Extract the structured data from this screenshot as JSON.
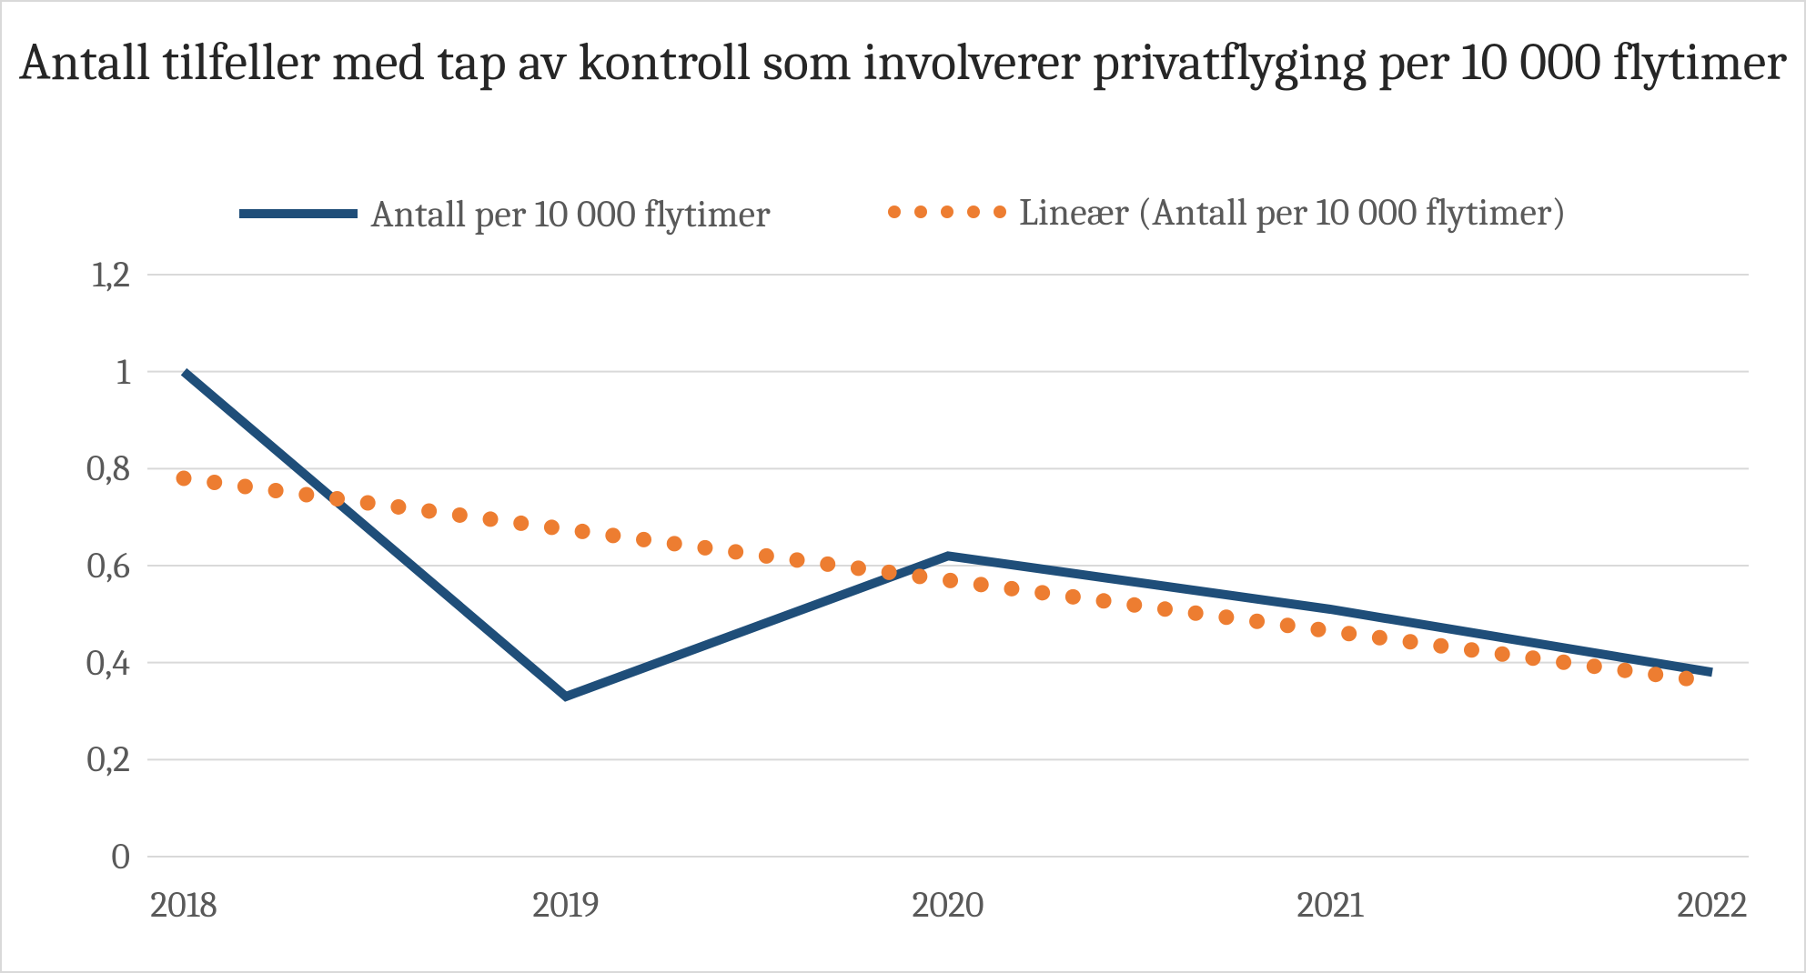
{
  "chart_data": {
    "type": "line",
    "title": "Antall tilfeller med tap av kontroll som involverer privatflyging per 10 000 flytimer",
    "xlabel": "",
    "ylabel": "",
    "categories": [
      "2018",
      "2019",
      "2020",
      "2021",
      "2022"
    ],
    "y_ticks": [
      "0",
      "0,2",
      "0,4",
      "0,6",
      "0,8",
      "1",
      "1,2"
    ],
    "ylim": [
      0,
      1.2
    ],
    "series": [
      {
        "name": "Antall per 10 000 flytimer",
        "style": "solid",
        "color": "#1f4e79",
        "values": [
          1.0,
          0.33,
          0.62,
          0.51,
          0.38
        ]
      },
      {
        "name": "Lineær (Antall per 10 000 flytimer)",
        "style": "dotted",
        "color": "#ed7d31",
        "values": [
          0.78,
          0.675,
          0.57,
          0.465,
          0.36
        ]
      }
    ],
    "legend_position": "top"
  }
}
